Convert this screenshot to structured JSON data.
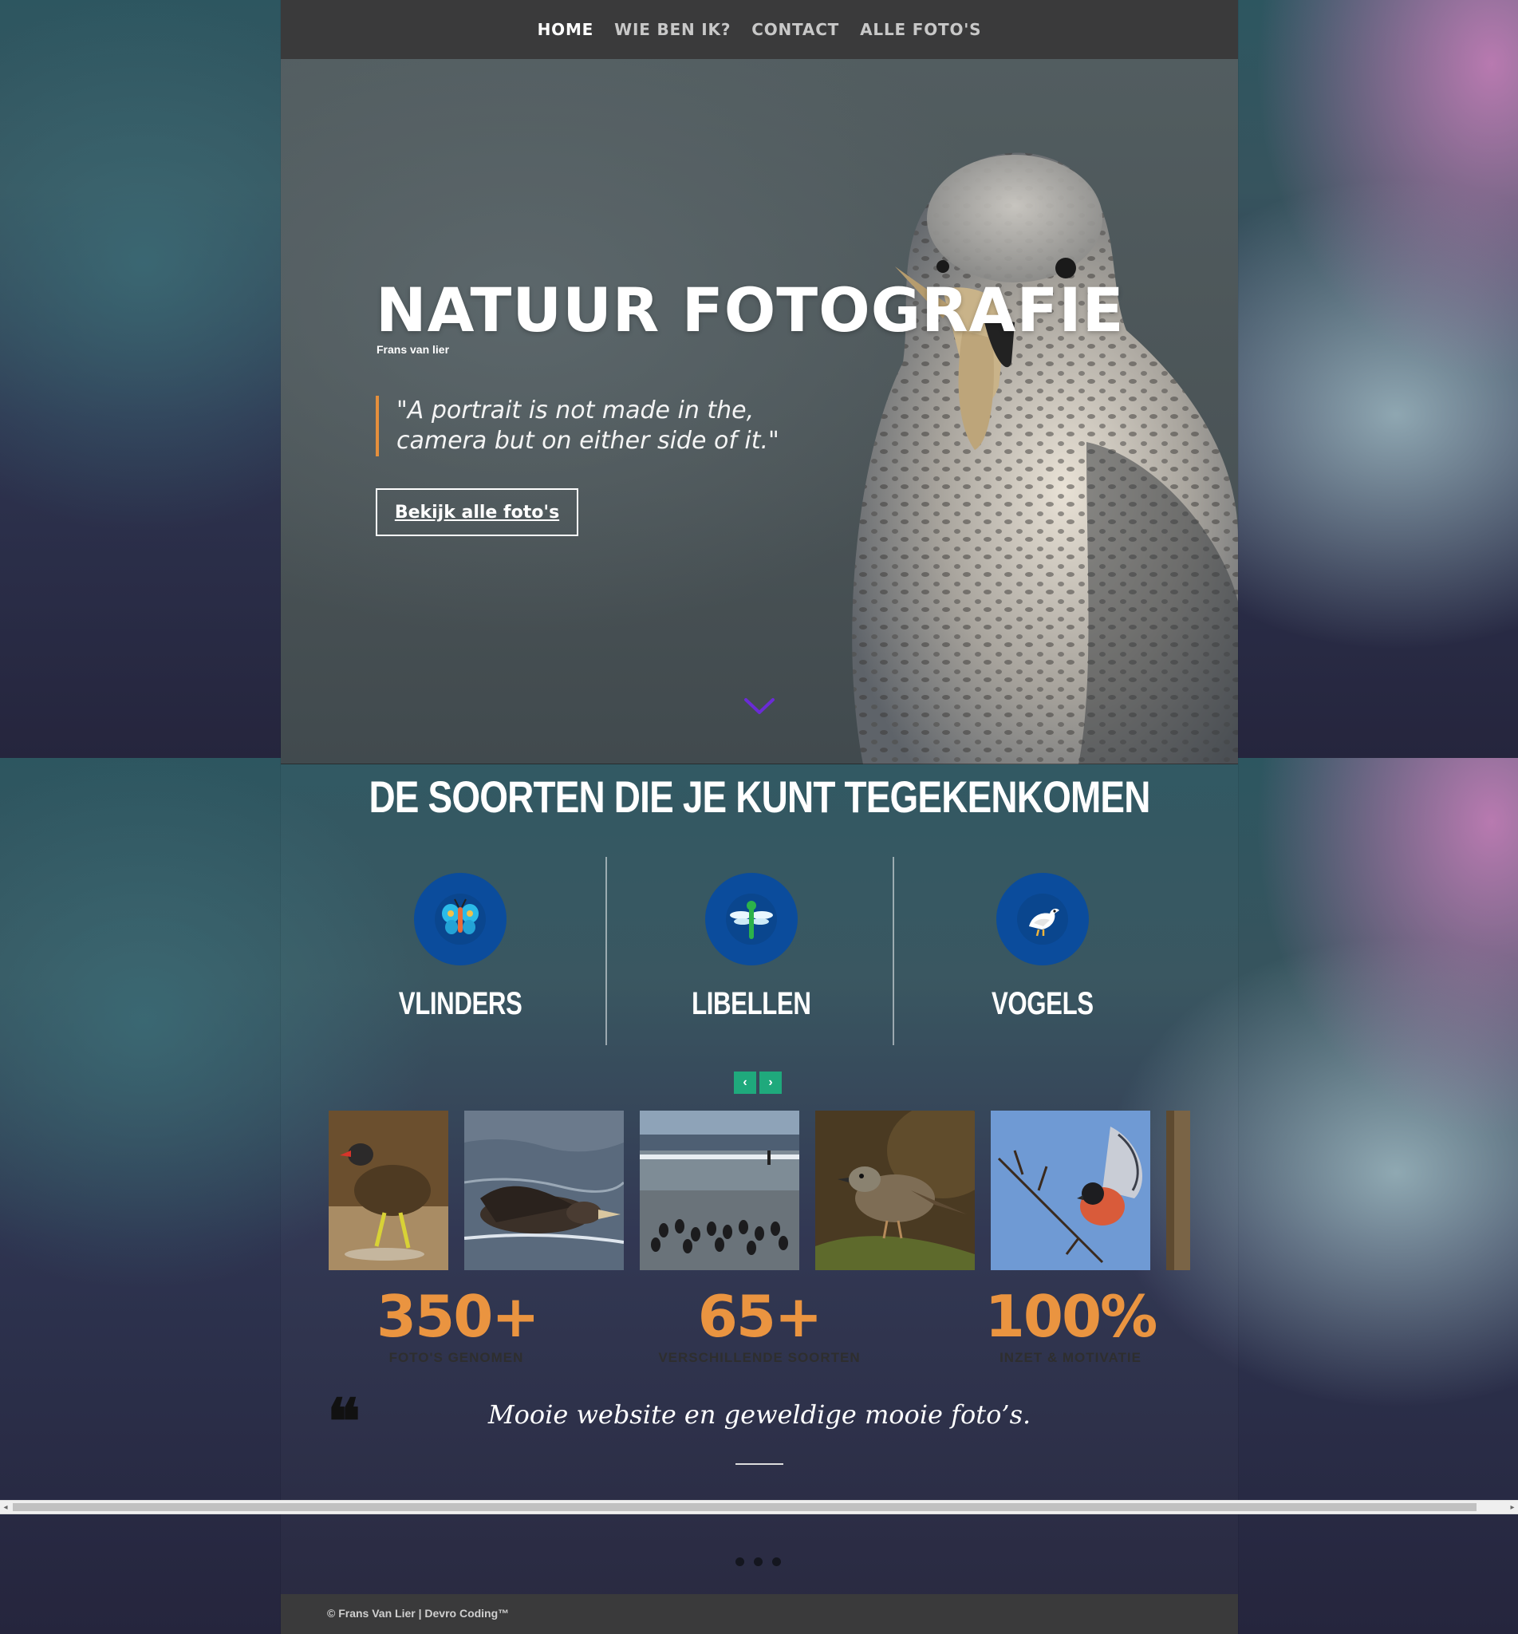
{
  "nav": {
    "items": [
      {
        "label": "HOME",
        "active": true
      },
      {
        "label": "WIE BEN IK?",
        "active": false
      },
      {
        "label": "CONTACT",
        "active": false
      },
      {
        "label": "ALLE FOTO'S",
        "active": false
      }
    ]
  },
  "hero": {
    "title": "NATUUR FOTOGRAFIE",
    "subtitle": "Frans van lier",
    "quote": "\"A portrait is not made in the, camera but on either side of it.\"",
    "button_label": "Bekijk alle foto's"
  },
  "species": {
    "title": "DE SOORTEN DIE JE KUNT TEGEKENKOMEN",
    "categories": [
      {
        "label": "VLINDERS",
        "icon": "butterfly-icon"
      },
      {
        "label": "LIBELLEN",
        "icon": "dragonfly-icon"
      },
      {
        "label": "VOGELS",
        "icon": "bird-icon"
      }
    ]
  },
  "carousel": {
    "prev_icon": "‹",
    "next_icon": "›",
    "photos": [
      {
        "name": "moorhen-photo"
      },
      {
        "name": "giant-petrel-photo"
      },
      {
        "name": "cormorants-beach-photo"
      },
      {
        "name": "dunnock-photo"
      },
      {
        "name": "bullfinch-photo"
      },
      {
        "name": "partial-photo"
      }
    ]
  },
  "stats": [
    {
      "number": "350+",
      "caption": "FOTO'S GENOMEN"
    },
    {
      "number": "65+",
      "caption": "VERSCHILLENDE SOORTEN"
    },
    {
      "number": "100%",
      "caption": "INZET & MOTIVATIE"
    }
  ],
  "testimonial": {
    "quote_mark": "❝",
    "text": "Mooie website en geweldige mooie foto’s."
  },
  "scrollbar": {
    "left": "◂",
    "right": "▸"
  },
  "slider_dots": 3,
  "footer": {
    "text": "© Frans Van Lier | Devro Coding™"
  },
  "colors": {
    "accent_orange": "#ea9440",
    "nav_bg": "#3a3a3b",
    "icon_circle": "#0b4c9c",
    "arrow_green": "#1fa97c"
  }
}
